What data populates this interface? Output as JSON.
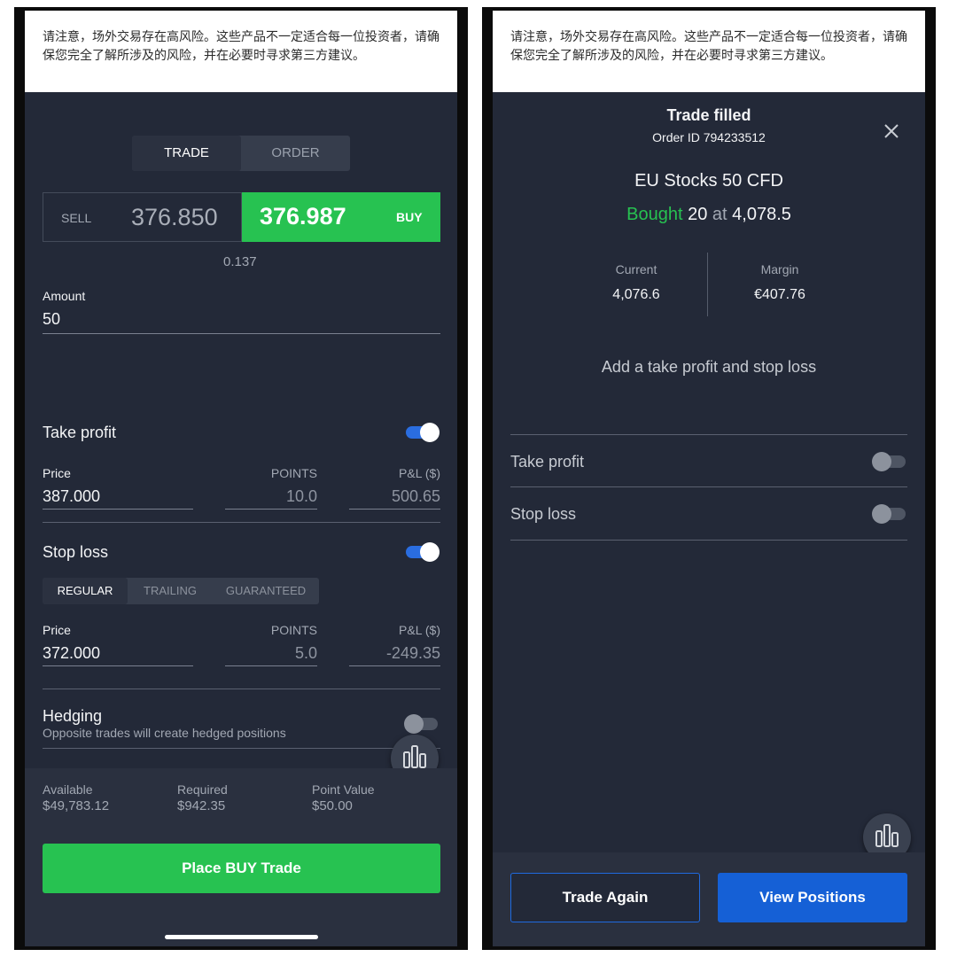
{
  "left": {
    "warning": "请注意，场外交易存在高风险。这些产品不一定适合每一位投资者，请确保您完全了解所涉及的风险，并在必要时寻求第三方建议。",
    "tabs": {
      "trade": "TRADE",
      "order": "ORDER",
      "active": "TRADE"
    },
    "sell": {
      "label": "SELL",
      "price": "376.850"
    },
    "buy": {
      "label": "BUY",
      "price": "376.987"
    },
    "spread": "0.137",
    "amount": {
      "label": "Amount",
      "value": "50"
    },
    "take_profit": {
      "label": "Take profit",
      "enabled": true,
      "price_label": "Price",
      "price": "387.000",
      "points_label": "POINTS",
      "points": "10.0",
      "pnl_label": "P&L ($)",
      "pnl": "500.65"
    },
    "stop_loss": {
      "label": "Stop loss",
      "enabled": true,
      "types": [
        "REGULAR",
        "TRAILING",
        "GUARANTEED"
      ],
      "active_type": "REGULAR",
      "price_label": "Price",
      "price": "372.000",
      "points_label": "POINTS",
      "points": "5.0",
      "pnl_label": "P&L ($)",
      "pnl": "-249.35"
    },
    "hedging": {
      "label": "Hedging",
      "description": "Opposite trades will create hedged positions",
      "enabled": false
    },
    "footer": {
      "available_label": "Available",
      "available": "$49,783.12",
      "required_label": "Required",
      "required": "$942.35",
      "point_value_label": "Point Value",
      "point_value": "$50.00"
    },
    "place_button": "Place BUY Trade",
    "fab_icon": "bar-chart-icon"
  },
  "right": {
    "warning": "请注意，场外交易存在高风险。这些产品不一定适合每一位投资者，请确保您完全了解所涉及的风险，并在必要时寻求第三方建议。",
    "title": "Trade filled",
    "order_id": "Order ID 794233512",
    "instrument": "EU Stocks 50 CFD",
    "fill": {
      "action": "Bought",
      "quantity": "20",
      "at": "at",
      "price": "4,078.5"
    },
    "current_label": "Current",
    "current": "4,076.6",
    "margin_label": "Margin",
    "margin": "€407.76",
    "prompt": "Add a take profit and stop loss",
    "take_profit": {
      "label": "Take profit",
      "enabled": false
    },
    "stop_loss": {
      "label": "Stop loss",
      "enabled": false
    },
    "trade_again": "Trade Again",
    "view_positions": "View Positions",
    "fab_icon": "bar-chart-icon",
    "close_icon": "close-icon"
  },
  "colors": {
    "buy_green": "#27c251",
    "blue": "#1560d6",
    "toggle_on": "#2a6de0",
    "bg": "#232938"
  }
}
